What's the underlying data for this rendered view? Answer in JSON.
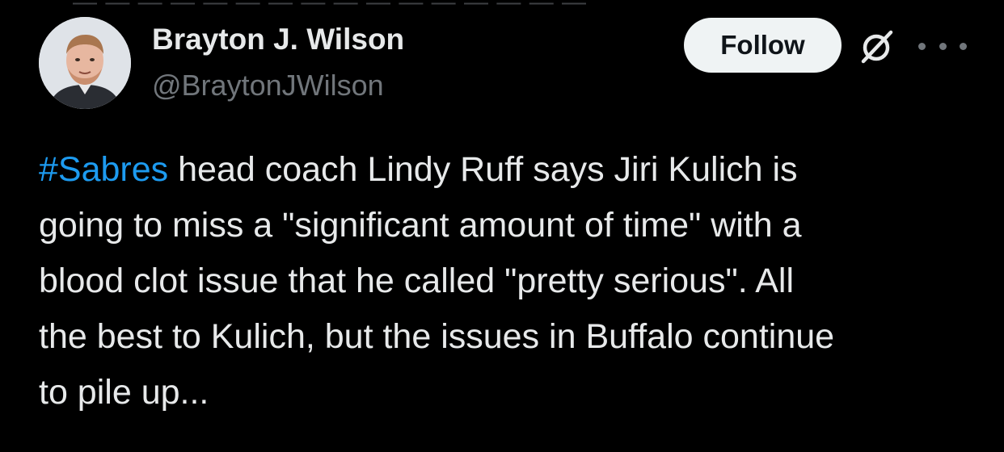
{
  "author": {
    "name": "Brayton J. Wilson",
    "handle": "@BraytonJWilson"
  },
  "actions": {
    "follow_label": "Follow",
    "grok_icon": "grok-icon",
    "more_icon": "more-icon"
  },
  "tweet": {
    "hashtag": "#Sabres",
    "lines": [
      " head coach Lindy Ruff says Jiri Kulich is",
      "going to miss a \"significant amount of time\" with a",
      "blood clot issue that he called \"pretty serious\". All",
      "the best to Kulich, but the issues in Buffalo continue",
      "to pile up..."
    ]
  },
  "colors": {
    "background": "#000000",
    "text": "#e7e9ea",
    "secondary": "#71767b",
    "link": "#1d9bf0",
    "follow_bg": "#eff3f4"
  }
}
